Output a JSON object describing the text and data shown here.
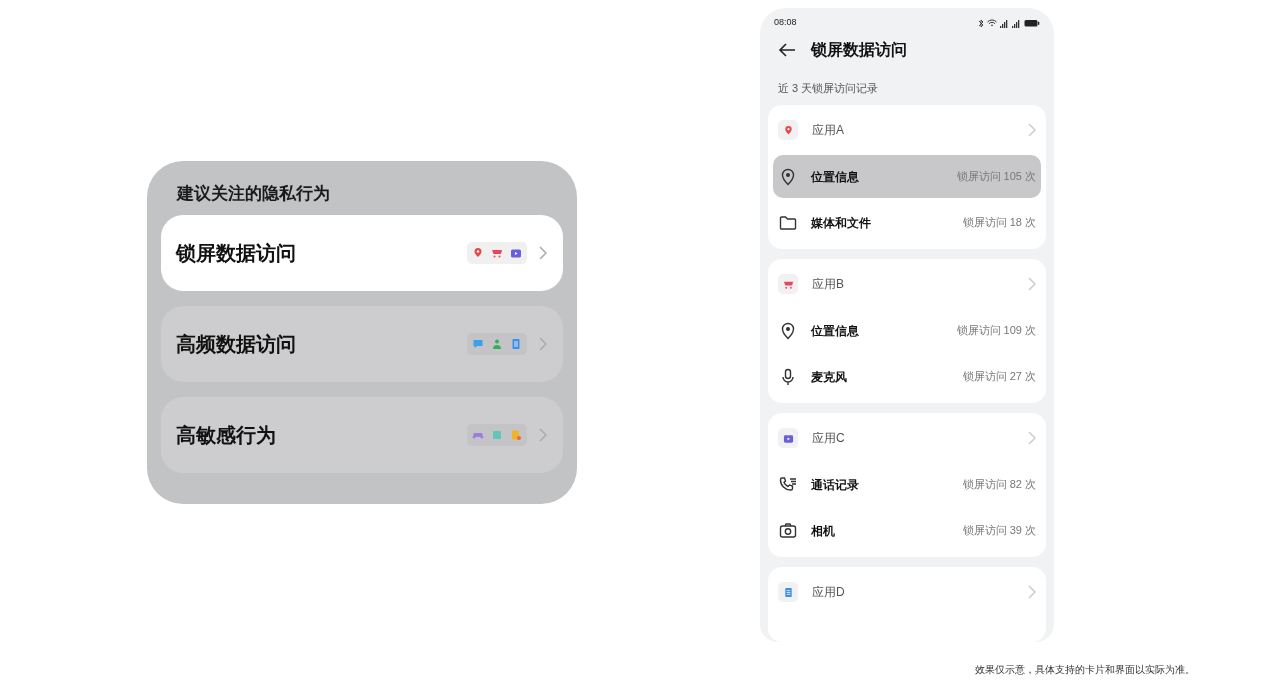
{
  "widget": {
    "title": "建议关注的隐私行为",
    "items": [
      {
        "label": "锁屏数据访问",
        "selected": true,
        "icons": [
          {
            "kind": "pin"
          },
          {
            "kind": "cart"
          },
          {
            "kind": "video"
          }
        ]
      },
      {
        "label": "高频数据访问",
        "selected": false,
        "icons": [
          {
            "kind": "chat"
          },
          {
            "kind": "person"
          },
          {
            "kind": "doc"
          }
        ]
      },
      {
        "label": "高敏感行为",
        "selected": false,
        "icons": [
          {
            "kind": "game"
          },
          {
            "kind": "book"
          },
          {
            "kind": "badge"
          }
        ]
      }
    ]
  },
  "phone": {
    "status_bar": {
      "time": "08:08"
    },
    "title": "锁屏数据访问",
    "section_label": "近 3 天锁屏访问记录",
    "apps": [
      {
        "name": "应用A",
        "kind": "pin",
        "permissions": [
          {
            "kind": "location",
            "name": "位置信息",
            "count": "锁屏访问 105 次",
            "selected": true
          },
          {
            "kind": "files",
            "name": "媒体和文件",
            "count": "锁屏访问 18 次",
            "selected": false
          }
        ]
      },
      {
        "name": "应用B",
        "kind": "cart",
        "permissions": [
          {
            "kind": "location",
            "name": "位置信息",
            "count": "锁屏访问 109 次",
            "selected": false
          },
          {
            "kind": "mic",
            "name": "麦克风",
            "count": "锁屏访问 27 次",
            "selected": false
          }
        ]
      },
      {
        "name": "应用C",
        "kind": "video",
        "permissions": [
          {
            "kind": "calls",
            "name": "通话记录",
            "count": "锁屏访问 82 次",
            "selected": false
          },
          {
            "kind": "camera",
            "name": "相机",
            "count": "锁屏访问 39 次",
            "selected": false
          }
        ]
      },
      {
        "name": "应用D",
        "kind": "doc"
      }
    ]
  },
  "footnote": "效果仅示意，具体支持的卡片和界面以实际为准。"
}
